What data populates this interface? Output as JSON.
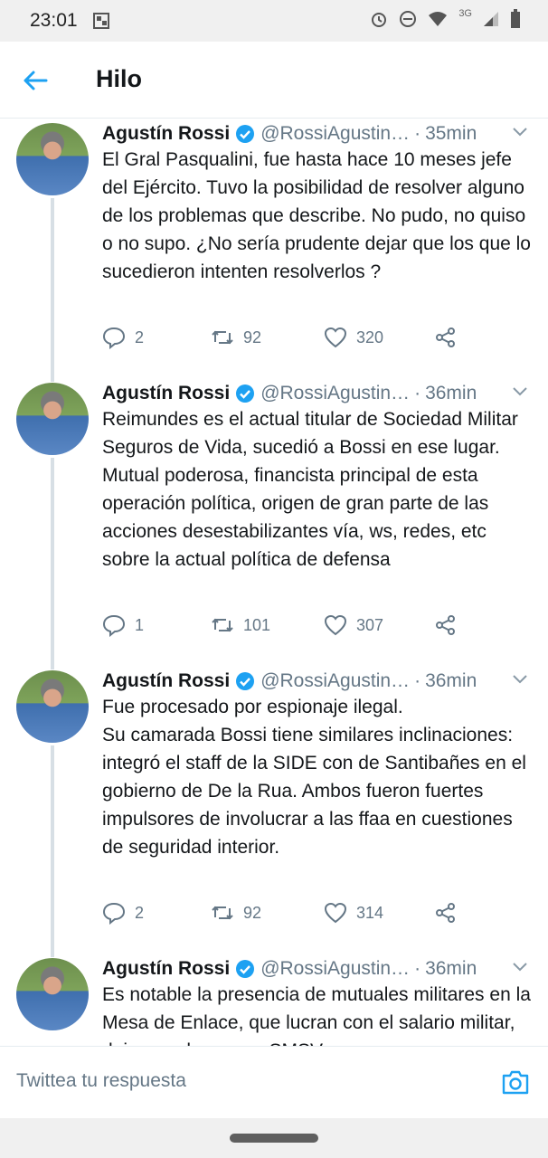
{
  "status_bar": {
    "time": "23:01",
    "network": "3G"
  },
  "app_bar": {
    "title": "Hilo"
  },
  "tweets": [
    {
      "name": "Agustín Rossi",
      "handle": "@RossiAgustin…",
      "time": "35min",
      "text": "El Gral Pasqualini, fue hasta hace 10 meses jefe del Ejército. Tuvo la posibilidad de resolver alguno de los problemas que describe. No pudo, no quiso  o no supo. ¿No sería prudente dejar que los que lo sucedieron intenten resolverlos ?",
      "replies": "2",
      "retweets": "92",
      "likes": "320"
    },
    {
      "name": "Agustín Rossi",
      "handle": "@RossiAgustin…",
      "time": "36min",
      "text": "Reimundes es el actual titular de Sociedad Militar Seguros de Vida, sucedió a Bossi en ese lugar. Mutual poderosa, financista principal de esta operación política, origen de gran parte de las acciones desestabilizantes vía, ws, redes, etc sobre la actual política de defensa",
      "replies": "1",
      "retweets": "101",
      "likes": "307"
    },
    {
      "name": "Agustín Rossi",
      "handle": "@RossiAgustin…",
      "time": "36min",
      "text": "Fue procesado por espionaje ilegal.\nSu camarada Bossi tiene similares inclinaciones: integró el staff de la SIDE con de Santibañes en el gobierno de De la Rua. Ambos fueron fuertes impulsores de involucrar a las ffaa en cuestiones de seguridad interior.",
      "replies": "2",
      "retweets": "92",
      "likes": "314"
    },
    {
      "name": "Agustín Rossi",
      "handle": "@RossiAgustin…",
      "time": "36min",
      "text": "Es notable la presencia de mutuales militares en la Mesa de Enlace, que lucran con el salario militar, dejan por lo menos SMSV"
    }
  ],
  "reply_bar": {
    "placeholder": "Twittea tu respuesta"
  },
  "colors": {
    "accent": "#1da1f2",
    "muted": "#657786",
    "text": "#14171a"
  }
}
